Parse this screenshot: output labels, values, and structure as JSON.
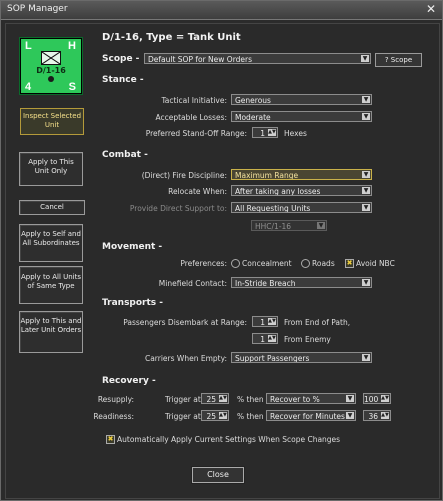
{
  "window": {
    "title": "SOP Manager",
    "close_glyph": "✕"
  },
  "unit": {
    "corner_tl": "L",
    "corner_tr": "H",
    "corner_bl": "4",
    "corner_br": "S",
    "label": "D/1-16",
    "header": "D/1-16, Type = Tank Unit",
    "badge_color": "#2ec85a"
  },
  "sidebar": {
    "inspect": "Inspect Selected Unit",
    "apply_this": "Apply to This Unit Only",
    "cancel": "Cancel",
    "apply_self_subs": "Apply to Self and All Subordinates",
    "apply_same_type": "Apply to All Units of Same Type",
    "apply_later": "Apply to This and Later Unit Orders"
  },
  "scope": {
    "label": "Scope -",
    "value": "Default SOP for New Orders",
    "button": "? Scope"
  },
  "stance": {
    "title": "Stance -",
    "tactical_initiative_label": "Tactical Initiative:",
    "tactical_initiative": "Generous",
    "acceptable_losses_label": "Acceptable Losses:",
    "acceptable_losses": "Moderate",
    "standoff_label": "Preferred Stand-Off Range:",
    "standoff_value": "1",
    "standoff_unit": "Hexes"
  },
  "combat": {
    "title": "Combat -",
    "fire_label": "(Direct) Fire Discipline:",
    "fire_value": "Maximum Range",
    "relocate_label": "Relocate When:",
    "relocate_value": "After taking any losses",
    "support_label": "Provide Direct Support to:",
    "support_value": "All Requesting Units",
    "support_unit": "HHC/1-16"
  },
  "movement": {
    "title": "Movement -",
    "pref_label": "Preferences:",
    "opt_concealment": "Concealment",
    "opt_roads": "Roads",
    "opt_avoid_nbc": "Avoid NBC",
    "minefield_label": "Minefield Contact:",
    "minefield_value": "In-Stride Breach"
  },
  "transports": {
    "title": "Transports -",
    "disembark_label": "Passengers Disembark at Range:",
    "path_value": "1",
    "path_suffix": "From End of Path,",
    "enemy_value": "1",
    "enemy_suffix": "From Enemy",
    "carriers_label": "Carriers When Empty:",
    "carriers_value": "Support Passengers"
  },
  "recovery": {
    "title": "Recovery -",
    "resupply_label": "Resupply:",
    "readiness_label": "Readiness:",
    "trigger_at": "Trigger at",
    "pct_then": "% then",
    "resupply_trigger": "25",
    "resupply_action": "Recover to %",
    "resupply_target": "100",
    "readiness_trigger": "25",
    "readiness_action": "Recover for Minutes",
    "readiness_target": "36"
  },
  "auto_apply_label": "Automatically Apply Current Settings When Scope Changes",
  "close_label": "Close"
}
